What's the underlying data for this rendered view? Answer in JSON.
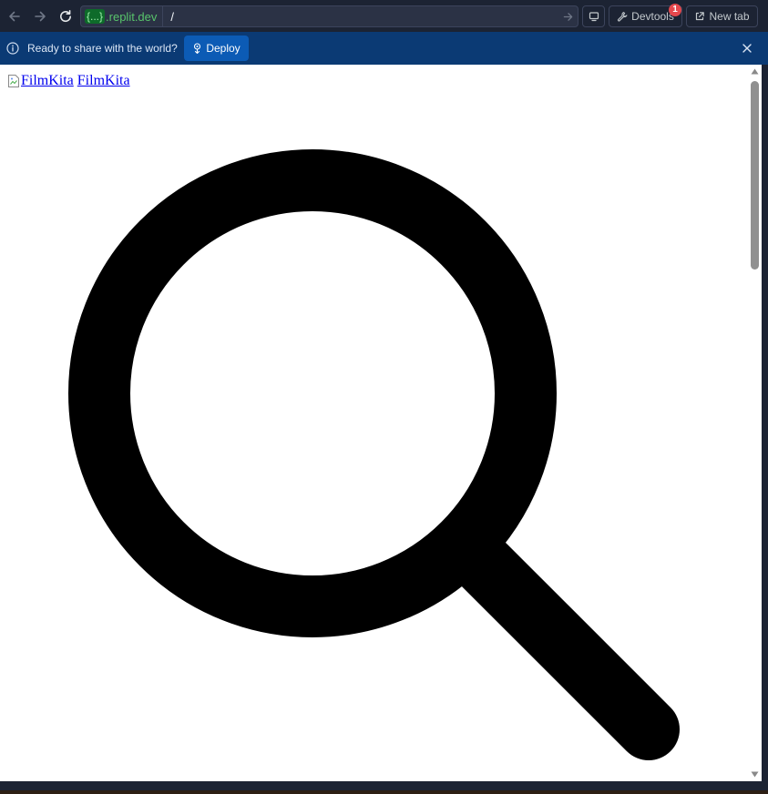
{
  "browser": {
    "url": {
      "host_token": "{...}",
      "host_suffix": ".replit.dev",
      "path": "/"
    },
    "devtools": {
      "label": "Devtools",
      "badge_count": "1"
    },
    "new_tab": {
      "label": "New tab"
    }
  },
  "banner": {
    "message": "Ready to share with the world?",
    "deploy_label": "Deploy"
  },
  "page": {
    "brand_image_alt": "FilmKita",
    "brand_text": "FilmKita"
  },
  "colors": {
    "toolbar_bg": "#1c2333",
    "banner_bg": "#0b3a74",
    "deploy_button": "#0c5bb5",
    "host_green": "#58c46b",
    "badge_red": "#e5484d",
    "link_blue": "#0000ee"
  },
  "icons": {
    "back": "arrow-left-icon",
    "forward": "arrow-right-icon",
    "reload": "reload-icon",
    "go": "arrow-right-icon",
    "device": "monitor-icon",
    "devtools": "wrench-icon",
    "new_tab": "external-link-icon",
    "info": "info-icon",
    "deploy": "deploy-icon",
    "close": "close-icon",
    "search": "search-icon"
  }
}
